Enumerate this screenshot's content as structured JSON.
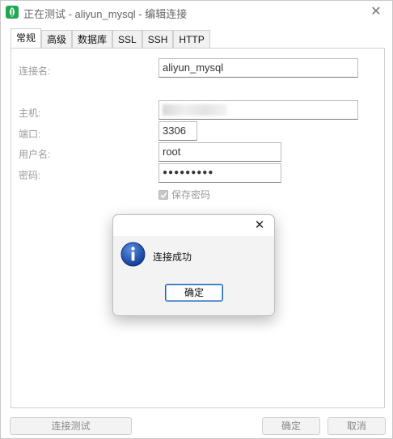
{
  "window": {
    "title": "正在测试 - aliyun_mysql - 编辑连接",
    "close_glyph": "✕"
  },
  "tabs": [
    {
      "label": "常规",
      "active": true
    },
    {
      "label": "高级"
    },
    {
      "label": "数据库"
    },
    {
      "label": "SSL"
    },
    {
      "label": "SSH"
    },
    {
      "label": "HTTP"
    }
  ],
  "form": {
    "connection_name_label": "连接名:",
    "connection_name_value": "aliyun_mysql",
    "host_label": "主机:",
    "host_value": "",
    "port_label": "端口:",
    "port_value": "3306",
    "username_label": "用户名:",
    "username_value": "root",
    "password_label": "密码:",
    "password_value": "●●●●●●●●●",
    "save_password_label": "保存密码",
    "save_password_checked": true
  },
  "buttons": {
    "test_connection": "连接测试",
    "ok": "确定",
    "cancel": "取消"
  },
  "dialog": {
    "close_glyph": "✕",
    "message": "连接成功",
    "ok_label": "确定",
    "icon": "info-icon"
  },
  "colors": {
    "accent": "#1a5fb4",
    "app_icon": "#1fa84f"
  }
}
